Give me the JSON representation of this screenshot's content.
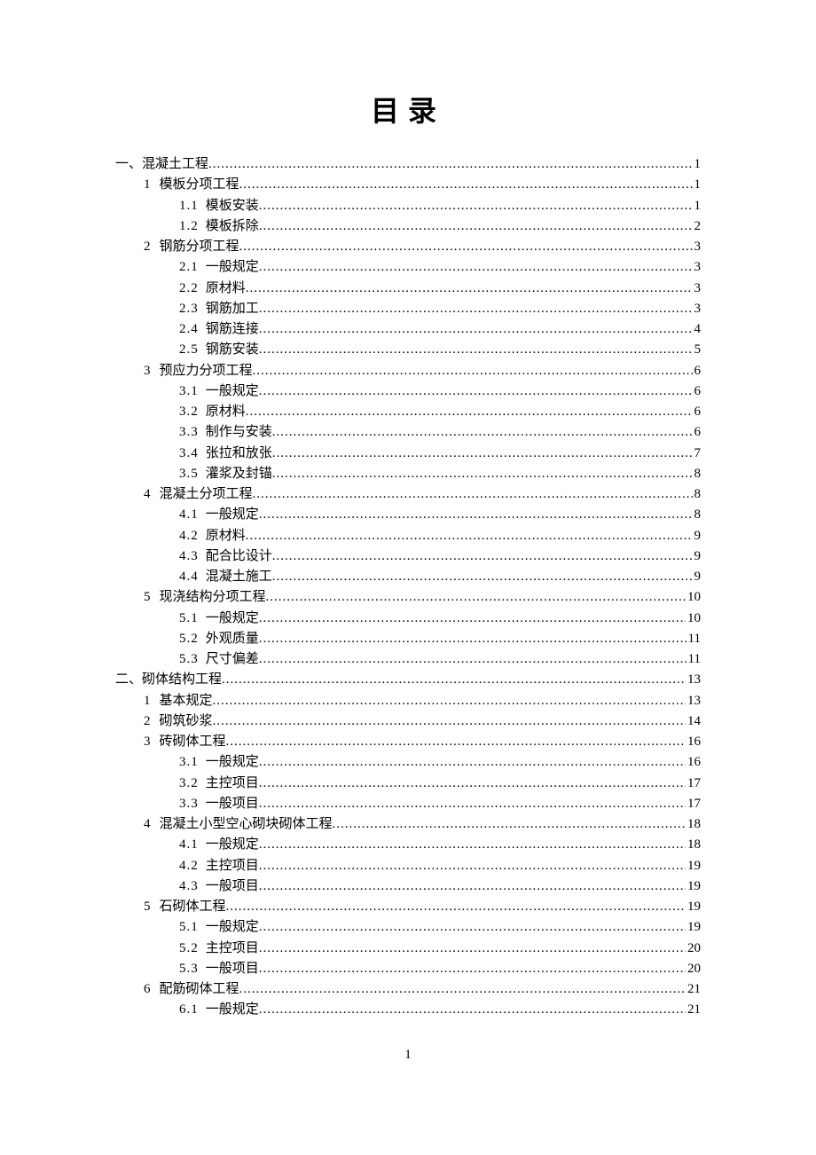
{
  "title": "目录",
  "page_number": "1",
  "entries": [
    {
      "level": 1,
      "num": "一、",
      "label": "混凝土工程",
      "page": "1"
    },
    {
      "level": 2,
      "num": "1",
      "label": "模板分项工程",
      "page": "1"
    },
    {
      "level": 3,
      "num": "1.1",
      "label": "模板安装",
      "page": "1"
    },
    {
      "level": 3,
      "num": "1.2",
      "label": "模板拆除",
      "page": "2"
    },
    {
      "level": 2,
      "num": "2",
      "label": "钢筋分项工程",
      "page": "3"
    },
    {
      "level": 3,
      "num": "2.1",
      "label": "一般规定",
      "page": "3"
    },
    {
      "level": 3,
      "num": "2.2",
      "label": "原材料",
      "page": "3"
    },
    {
      "level": 3,
      "num": "2.3",
      "label": "钢筋加工",
      "page": "3"
    },
    {
      "level": 3,
      "num": "2.4",
      "label": "钢筋连接",
      "page": "4"
    },
    {
      "level": 3,
      "num": "2.5",
      "label": "钢筋安装",
      "page": "5"
    },
    {
      "level": 2,
      "num": "3",
      "label": "预应力分项工程",
      "page": "6"
    },
    {
      "level": 3,
      "num": "3.1",
      "label": "一般规定",
      "page": "6"
    },
    {
      "level": 3,
      "num": "3.2",
      "label": "原材料",
      "page": "6"
    },
    {
      "level": 3,
      "num": "3.3",
      "label": "制作与安装",
      "page": "6"
    },
    {
      "level": 3,
      "num": "3.4",
      "label": "张拉和放张",
      "page": "7"
    },
    {
      "level": 3,
      "num": "3.5",
      "label": "灌浆及封锚",
      "page": "8"
    },
    {
      "level": 2,
      "num": "4",
      "label": "混凝土分项工程",
      "page": "8"
    },
    {
      "level": 3,
      "num": "4.1",
      "label": "一般规定",
      "page": "8"
    },
    {
      "level": 3,
      "num": "4.2",
      "label": "原材料",
      "page": "9"
    },
    {
      "level": 3,
      "num": "4.3",
      "label": "配合比设计",
      "page": "9"
    },
    {
      "level": 3,
      "num": "4.4",
      "label": "混凝土施工",
      "page": "9"
    },
    {
      "level": 2,
      "num": "5",
      "label": "现浇结构分项工程",
      "page": "10"
    },
    {
      "level": 3,
      "num": "5.1",
      "label": "一般规定",
      "page": "10"
    },
    {
      "level": 3,
      "num": "5.2",
      "label": "外观质量",
      "page": "11"
    },
    {
      "level": 3,
      "num": "5.3",
      "label": "尺寸偏差",
      "page": "11"
    },
    {
      "level": 1,
      "num": "二、",
      "label": "砌体结构工程",
      "page": "13"
    },
    {
      "level": 2,
      "num": "1",
      "label": "基本规定",
      "page": "13"
    },
    {
      "level": 2,
      "num": "2",
      "label": "砌筑砂浆",
      "page": "14"
    },
    {
      "level": 2,
      "num": "3",
      "label": "砖砌体工程",
      "page": "16"
    },
    {
      "level": 3,
      "num": "3.1",
      "label": "一般规定",
      "page": "16"
    },
    {
      "level": 3,
      "num": "3.2",
      "label": "主控项目",
      "page": "17"
    },
    {
      "level": 3,
      "num": "3.3",
      "label": "一般项目",
      "page": "17"
    },
    {
      "level": 2,
      "num": "4",
      "label": "混凝土小型空心砌块砌体工程",
      "page": "18"
    },
    {
      "level": 3,
      "num": "4.1",
      "label": "一般规定",
      "page": "18"
    },
    {
      "level": 3,
      "num": "4.2",
      "label": "主控项目",
      "page": "19"
    },
    {
      "level": 3,
      "num": "4.3",
      "label": "一般项目",
      "page": "19"
    },
    {
      "level": 2,
      "num": "5",
      "label": "石砌体工程",
      "page": "19"
    },
    {
      "level": 3,
      "num": "5.1",
      "label": "一般规定",
      "page": "19"
    },
    {
      "level": 3,
      "num": "5.2",
      "label": "主控项目",
      "page": "20"
    },
    {
      "level": 3,
      "num": "5.3",
      "label": "一般项目",
      "page": "20"
    },
    {
      "level": 2,
      "num": "6",
      "label": "配筋砌体工程",
      "page": "21"
    },
    {
      "level": 3,
      "num": "6.1",
      "label": "一般规定",
      "page": "21"
    }
  ]
}
